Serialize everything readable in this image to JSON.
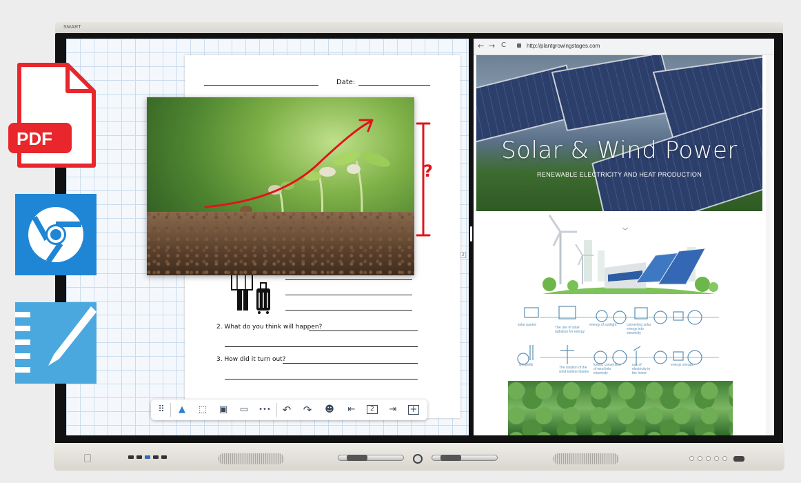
{
  "monitor": {
    "brand": "SMART"
  },
  "worksheet": {
    "date_label": "Date:",
    "q2": "2. What do you think will happen?",
    "q3": "3. How did it turn out?",
    "annotation_mark": "?"
  },
  "toolbar": {
    "items": [
      {
        "icon": "drag-handle-icon",
        "glyph": "⠿"
      },
      {
        "icon": "pen-icon",
        "glyph": "▲"
      },
      {
        "icon": "select-icon",
        "glyph": "⬚"
      },
      {
        "icon": "add-image-icon",
        "glyph": "▣"
      },
      {
        "icon": "chat-icon",
        "glyph": "▭"
      },
      {
        "icon": "more-icon",
        "glyph": "•••"
      },
      {
        "icon": "undo-icon",
        "glyph": "↶"
      },
      {
        "icon": "redo-icon",
        "glyph": "↷"
      },
      {
        "icon": "students-icon",
        "glyph": "☻"
      },
      {
        "icon": "previous-page-icon",
        "glyph": "⇤"
      },
      {
        "icon": "page-number-icon",
        "glyph": "2"
      },
      {
        "icon": "next-page-icon",
        "glyph": "⇥"
      },
      {
        "icon": "add-page-icon",
        "glyph": "+"
      }
    ],
    "page_number": "2"
  },
  "browser": {
    "url": "http://plantgrowingstages.com",
    "back_glyph": "←",
    "forward_glyph": "→",
    "reload_glyph": "C"
  },
  "hero": {
    "title": "Solar & Wind Power",
    "subtitle": "RENEWABLE ELECTRICITY AND HEAT PRODUCTION"
  },
  "infographic": {
    "row1_label": "solar panels",
    "row1_b": "The use of solar radiation for energy",
    "row1_c": "energy of sunlight",
    "row1_d": "converting solar energy into electricity",
    "row2_label": "windmills",
    "row2_b": "The rotation of the wind turbine blades",
    "row2_c": "kinetic conversion of wind into electricity",
    "row2_d": "use of electricity in the home",
    "row2_e": "energy storage"
  },
  "side_apps": [
    {
      "name": "PDF",
      "color": "#e8262b"
    },
    {
      "name": "Chrome",
      "color": "#1f86d6"
    },
    {
      "name": "Notebook",
      "color": "#4aa8de"
    }
  ],
  "colors": {
    "pdf_red": "#e8262b",
    "chrome_blue": "#1f86d6",
    "notebook_blue": "#4aa8de",
    "annotation_red": "#e0141b",
    "grid_line": "#c9dcee"
  }
}
